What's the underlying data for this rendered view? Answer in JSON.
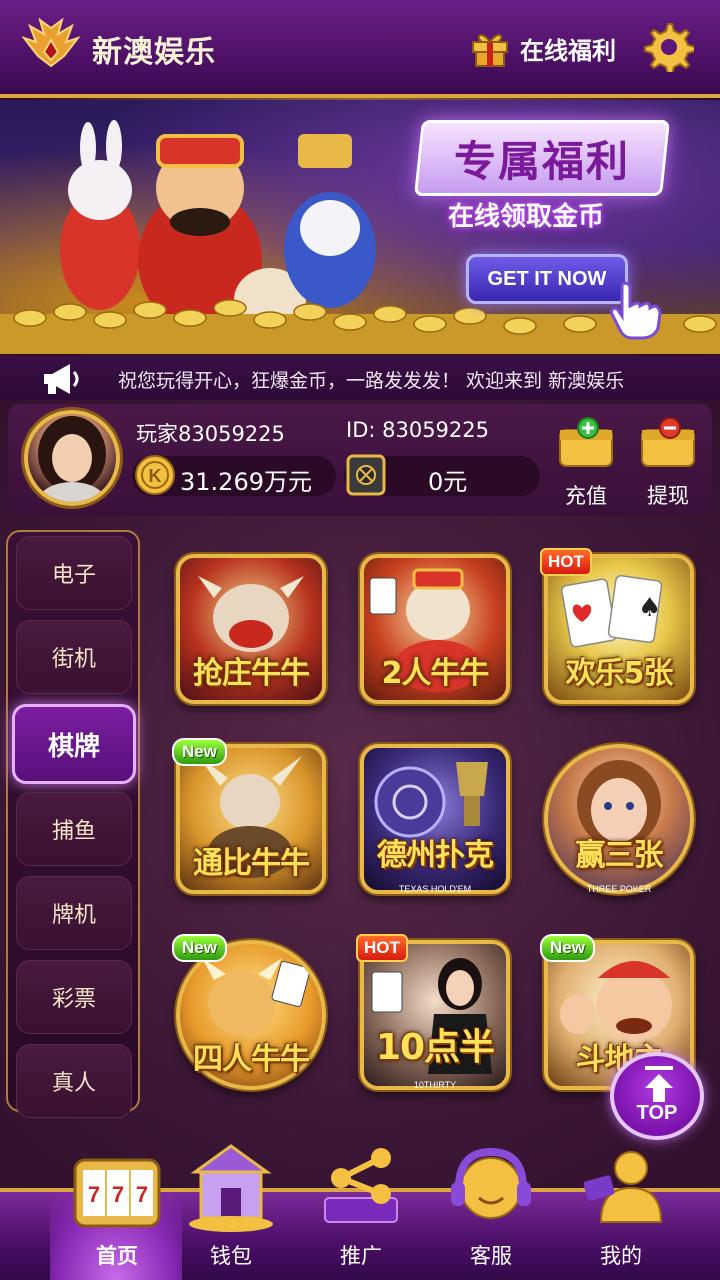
{
  "header": {
    "title": "新澳娱乐",
    "gift_label": "在线福利",
    "logo_icon": "phoenix-wings-logo",
    "settings_icon": "gear-icon"
  },
  "banner": {
    "title": "专属福利",
    "subtitle": "在线领取金币",
    "cta_label": "GET IT NOW"
  },
  "marquee": {
    "text": "祝您玩得开心，狂爆金币，一路发发发！ 欢迎来到 新澳娱乐"
  },
  "player": {
    "name": "玩家83059225",
    "id_text": "ID: 83059225",
    "balance": "31.269万元",
    "safe_balance": "0元",
    "deposit_label": "充值",
    "withdraw_label": "提现"
  },
  "categories": [
    {
      "label": "电子",
      "active": false
    },
    {
      "label": "街机",
      "active": false
    },
    {
      "label": "棋牌",
      "active": true
    },
    {
      "label": "捕鱼",
      "active": false
    },
    {
      "label": "牌机",
      "active": false
    },
    {
      "label": "彩票",
      "active": false
    },
    {
      "label": "真人",
      "active": false
    }
  ],
  "games": [
    {
      "title": "抢庄牛牛",
      "subtitle": "",
      "badge": ""
    },
    {
      "title": "2人牛牛",
      "subtitle": "",
      "badge": ""
    },
    {
      "title": "欢乐5张",
      "subtitle": "",
      "badge": "HOT"
    },
    {
      "title": "通比牛牛",
      "subtitle": "",
      "badge": "New"
    },
    {
      "title": "德州扑克",
      "subtitle": "TEXAS HOLD'EM",
      "badge": ""
    },
    {
      "title": "赢三张",
      "subtitle": "THREE POKER",
      "badge": ""
    },
    {
      "title": "四人牛牛",
      "subtitle": "",
      "badge": "New"
    },
    {
      "title": "10点半",
      "subtitle": "10THIRTY",
      "badge": "HOT"
    },
    {
      "title": "斗地主",
      "subtitle": "",
      "badge": "New"
    }
  ],
  "top_button": {
    "label": "TOP"
  },
  "nav": [
    {
      "label": "首页",
      "icon": "slot-777-icon",
      "active": true
    },
    {
      "label": "钱包",
      "icon": "treasure-building-icon",
      "active": false
    },
    {
      "label": "推广",
      "icon": "share-network-icon",
      "active": false
    },
    {
      "label": "客服",
      "icon": "headset-support-icon",
      "active": false
    },
    {
      "label": "我的",
      "icon": "user-profile-icon",
      "active": false
    }
  ],
  "colors": {
    "gold": "#e8b848",
    "purple_header": "#5a1678",
    "active_purple": "#7a1ea0"
  }
}
